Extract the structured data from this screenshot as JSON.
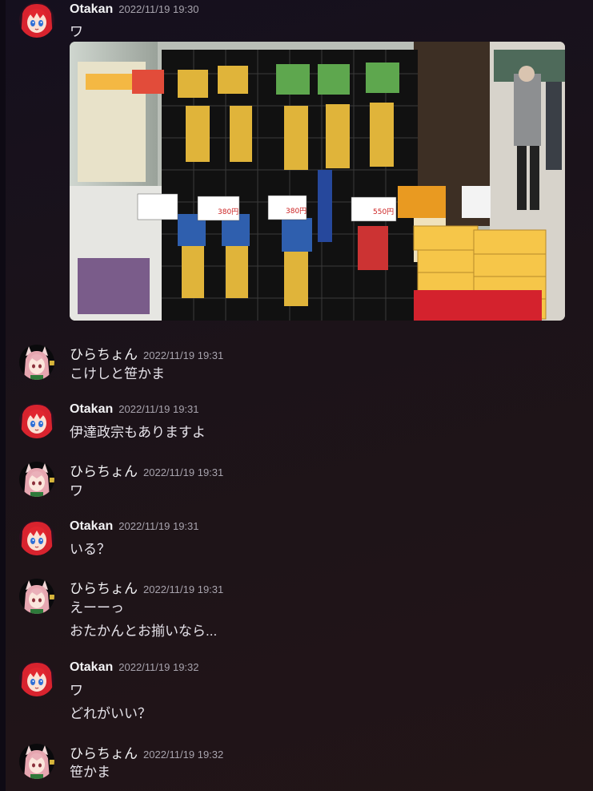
{
  "messages": [
    {
      "author": "Otakan",
      "timestamp": "2022/11/19 19:30",
      "lines": [
        "ワ"
      ],
      "has_image": true
    },
    {
      "author": "ひらちょん",
      "timestamp": "2022/11/19 19:31",
      "lines": [
        "こけしと笹かま"
      ]
    },
    {
      "author": "Otakan",
      "timestamp": "2022/11/19 19:31",
      "lines": [
        "伊達政宗もありますよ"
      ]
    },
    {
      "author": "ひらちょん",
      "timestamp": "2022/11/19 19:31",
      "lines": [
        "ワ"
      ]
    },
    {
      "author": "Otakan",
      "timestamp": "2022/11/19 19:31",
      "lines": [
        "いる？"
      ]
    },
    {
      "author": "ひらちょん",
      "timestamp": "2022/11/19 19:31",
      "lines": [
        "えーーっ",
        "おたかんとお揃いなら..."
      ]
    },
    {
      "author": "Otakan",
      "timestamp": "2022/11/19 19:32",
      "lines": [
        "ワ",
        "どれがいい？"
      ]
    },
    {
      "author": "ひらちょん",
      "timestamp": "2022/11/19 19:32",
      "lines": [
        "笹かま"
      ]
    }
  ],
  "photo_signs": [
    "380円",
    "380円",
    "550円"
  ],
  "colors": {
    "background": "#1c1319",
    "username": "#f2f2f4",
    "timestamp": "#a7a3ad",
    "message_text": "#e6e3ea"
  }
}
